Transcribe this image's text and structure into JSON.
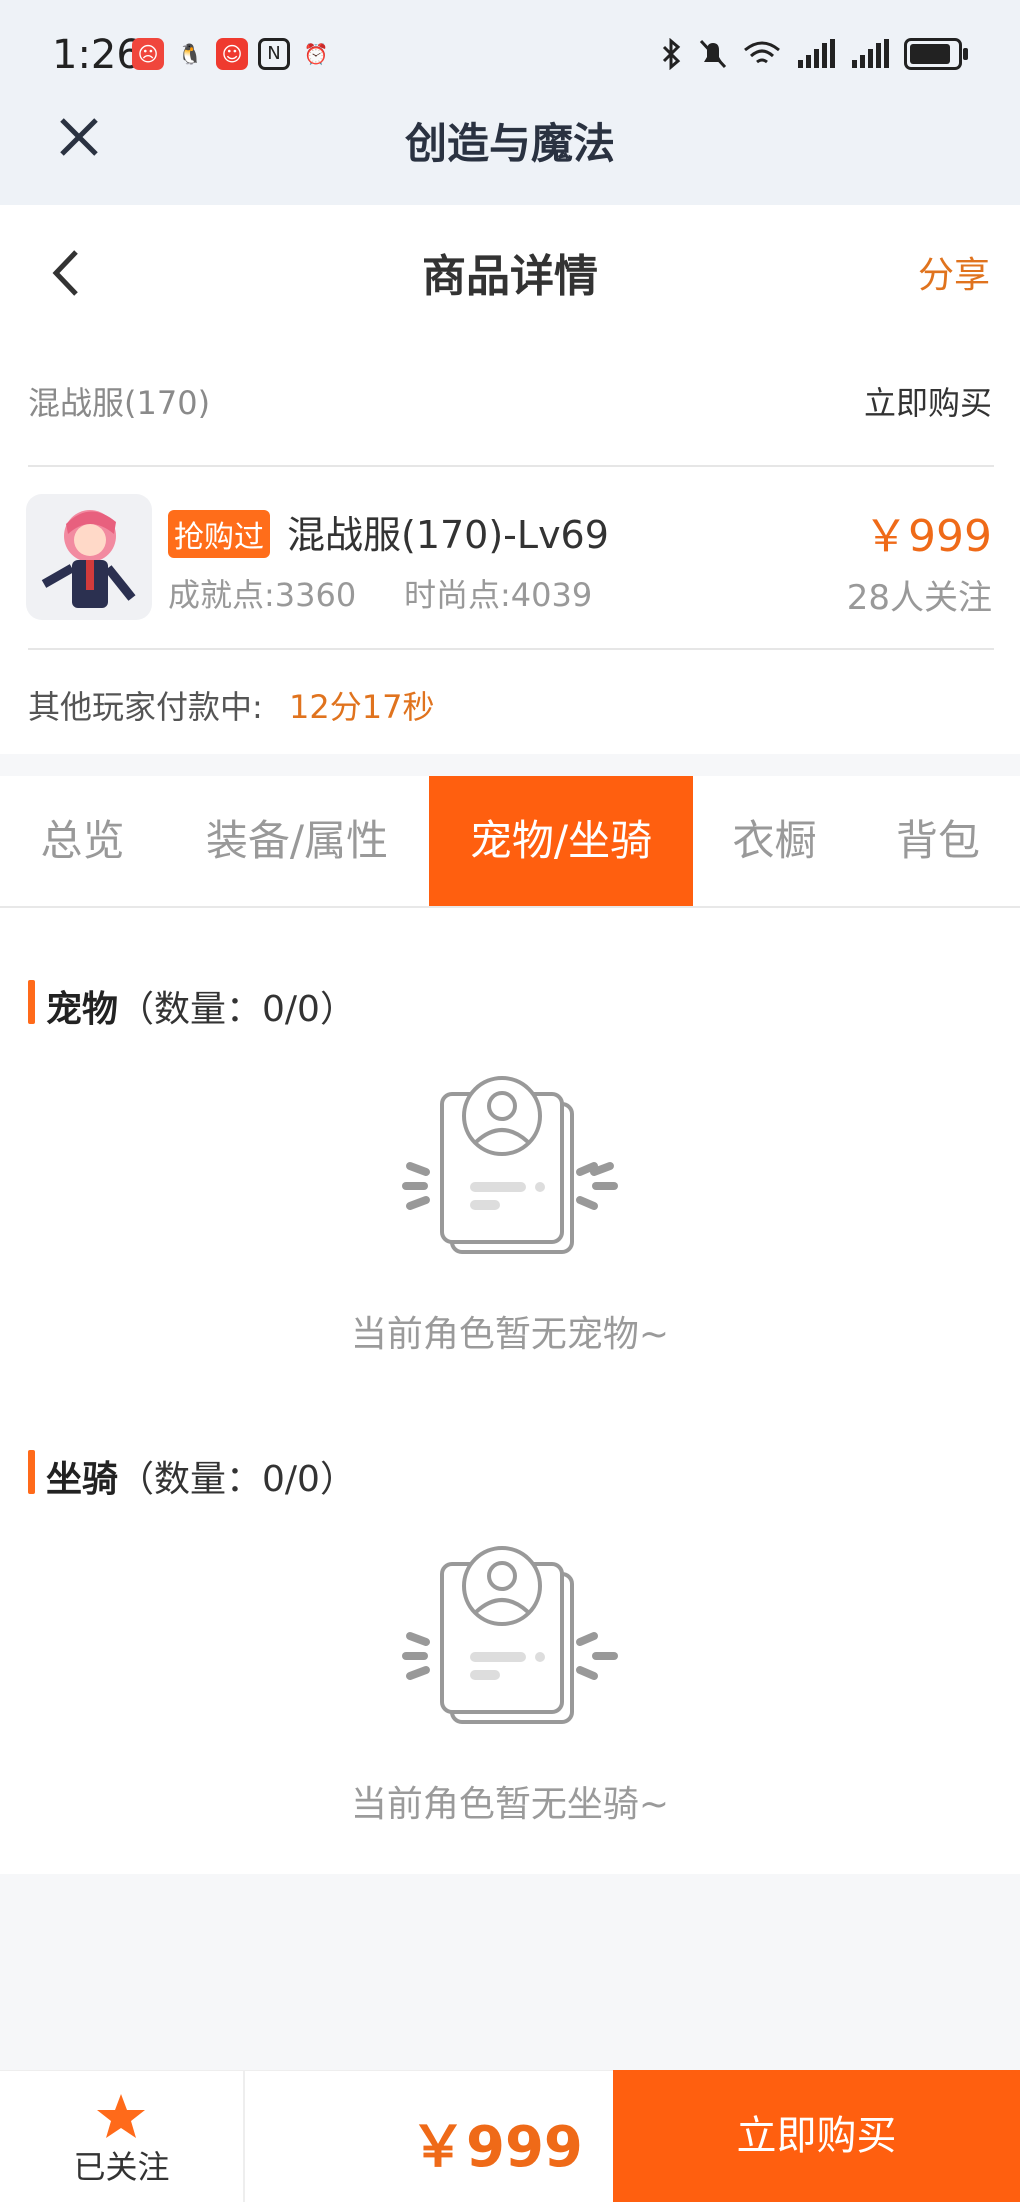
{
  "status_bar": {
    "time": "1:26"
  },
  "app_bar": {
    "title": "创造与魔法"
  },
  "nav": {
    "title": "商品详情",
    "share": "分享"
  },
  "listing": {
    "server": "混战服(170)",
    "buy_now_link": "立即购买",
    "badge": "抢购过",
    "name": "混战服(170)-Lv69",
    "achievement": "成就点:3360",
    "fashion": "时尚点:4039",
    "price": "￥999",
    "followers": "28人关注",
    "pay_label": "其他玩家付款中:",
    "pay_time": "12分17秒"
  },
  "tabs": [
    {
      "label": "总览"
    },
    {
      "label": "装备/属性"
    },
    {
      "label": "宠物/坐骑",
      "active": true
    },
    {
      "label": "衣橱"
    },
    {
      "label": "背包"
    }
  ],
  "sections": {
    "pets": {
      "title": "宠物",
      "count": "（数量：0/0）",
      "empty": "当前角色暂无宠物~"
    },
    "mounts": {
      "title": "坐骑",
      "count": "（数量：0/0）",
      "empty": "当前角色暂无坐骑~"
    }
  },
  "bottom": {
    "follow_label": "已关注",
    "price": "￥999",
    "buy_label": "立即购买"
  },
  "colors": {
    "accent": "#ff5f0f",
    "price": "#ef6a18"
  }
}
